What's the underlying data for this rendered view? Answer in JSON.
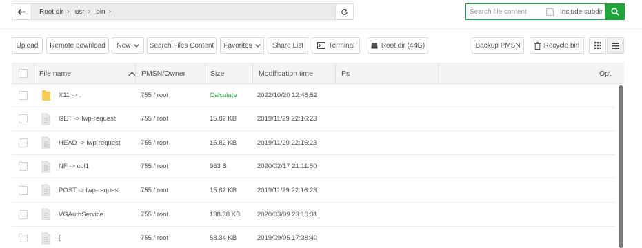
{
  "path": {
    "crumbs": [
      "Root dir",
      "usr",
      "bin"
    ]
  },
  "search": {
    "placeholder": "Search file content",
    "subdir_label": "Include subdir"
  },
  "toolbar": {
    "upload": "Upload",
    "remote_download": "Remote download",
    "new": "New",
    "search_files_content": "Search Files Content",
    "favorites": "Favorites",
    "share_list": "Share List",
    "terminal": "Terminal",
    "root_dir": "Root dir (44G)",
    "backup": "Backup PMSN",
    "recycle_bin": "Recycle bin"
  },
  "columns": {
    "name": "File name",
    "perm": "PMSN/Owner",
    "size": "Size",
    "mtime": "Modification time",
    "ps": "Ps",
    "opt": "Opt"
  },
  "files": [
    {
      "name": "X11 -> .",
      "type": "folder",
      "perm": "755 / root",
      "size": "Calculate",
      "mtime": "2022/10/20 12:46:52"
    },
    {
      "name": "GET -> lwp-request",
      "type": "file",
      "perm": "755 / root",
      "size": "15.82 KB",
      "mtime": "2019/11/29 22:16:23"
    },
    {
      "name": "HEAD -> lwp-request",
      "type": "file",
      "perm": "755 / root",
      "size": "15.82 KB",
      "mtime": "2019/11/29 22:16:23"
    },
    {
      "name": "NF -> col1",
      "type": "file",
      "perm": "755 / root",
      "size": "963 B",
      "mtime": "2020/02/17 21:11:50"
    },
    {
      "name": "POST -> lwp-request",
      "type": "file",
      "perm": "755 / root",
      "size": "15.82 KB",
      "mtime": "2019/11/29 22:16:23"
    },
    {
      "name": "VGAuthService",
      "type": "file",
      "perm": "755 / root",
      "size": "138.38 KB",
      "mtime": "2020/03/09 23:10:31"
    },
    {
      "name": "[",
      "type": "file",
      "perm": "755 / root",
      "size": "58.34 KB",
      "mtime": "2019/09/05 17:38:40"
    }
  ],
  "colors": {
    "accent": "#20a53a",
    "header_bg": "#f4f4f4",
    "folder": "#f5c342"
  }
}
